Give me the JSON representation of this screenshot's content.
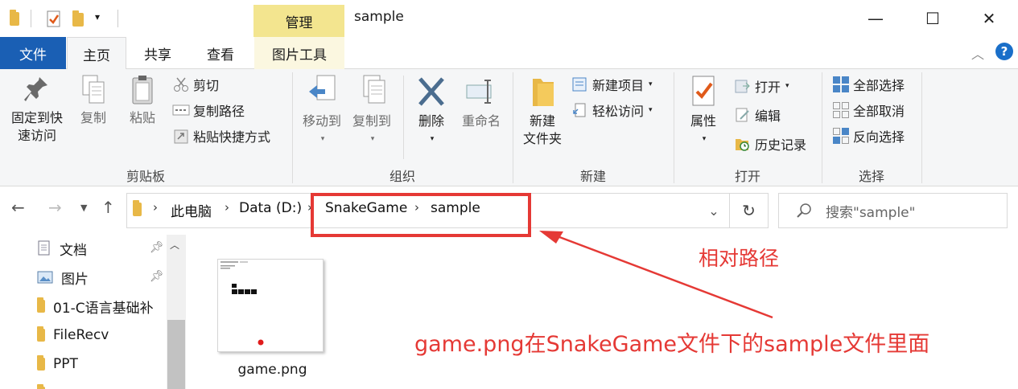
{
  "window": {
    "title": "sample",
    "context_tab": "管理",
    "controls": {
      "minimize": "—",
      "maximize": "☐",
      "close": "✕"
    }
  },
  "ribbon_tabs": [
    "文件",
    "主页",
    "共享",
    "查看",
    "图片工具"
  ],
  "ribbon": {
    "clipboard": {
      "pin": "固定到快\n速访问",
      "copy": "复制",
      "paste": "粘贴",
      "cut": "剪切",
      "copy_path": "复制路径",
      "paste_shortcut": "粘贴快捷方式",
      "label": "剪贴板"
    },
    "organize": {
      "move_to": "移动到",
      "copy_to": "复制到",
      "delete": "删除",
      "rename": "重命名",
      "label": "组织"
    },
    "new": {
      "new_folder": "新建\n文件夹",
      "new_item": "新建项目",
      "easy_access": "轻松访问",
      "label": "新建"
    },
    "open": {
      "properties": "属性",
      "open": "打开",
      "edit": "编辑",
      "history": "历史记录",
      "label": "打开"
    },
    "select": {
      "select_all": "全部选择",
      "select_none": "全部取消",
      "invert": "反向选择",
      "label": "选择"
    }
  },
  "address": {
    "crumbs": [
      "此电脑",
      "Data (D:)",
      "SnakeGame",
      "sample"
    ],
    "search_placeholder": "搜索\"sample\""
  },
  "nav_pane": {
    "items": [
      {
        "label": "文档",
        "pinned": true
      },
      {
        "label": "图片",
        "pinned": true
      },
      {
        "label": "01-C语言基础补",
        "pinned": false
      },
      {
        "label": "FileRecv",
        "pinned": false
      },
      {
        "label": "PPT",
        "pinned": false
      }
    ]
  },
  "files": [
    {
      "name": "game.png"
    }
  ],
  "annotations": {
    "relative_path": "相对路径",
    "explanation": "game.png在SnakeGame文件下的sample文件里面"
  },
  "colors": {
    "file_tab": "#1a5fb4",
    "context_tab": "#f3e58f",
    "annotation_red": "#e53935"
  }
}
